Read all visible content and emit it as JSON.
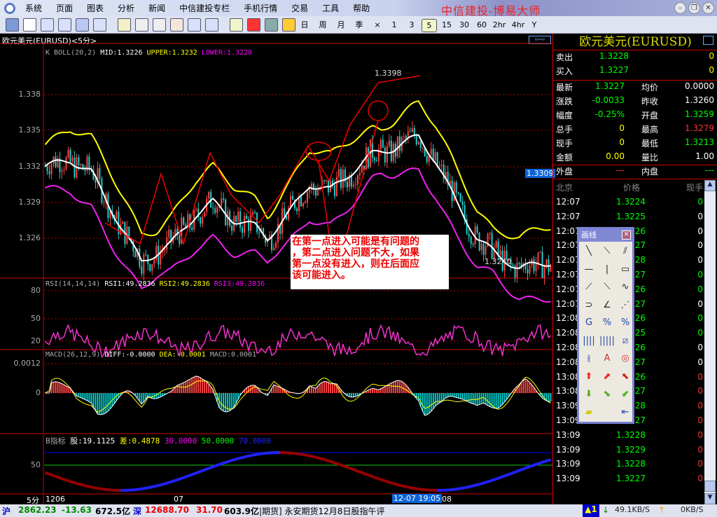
{
  "window": {
    "title": "中信建投-博易大师",
    "min": "–",
    "restore": "❐",
    "close": "✕"
  },
  "menu": [
    "系统",
    "页面",
    "图表",
    "分析",
    "新闻",
    "中信建投专栏",
    "手机行情",
    "交易",
    "工具",
    "帮助"
  ],
  "toolbar": {
    "periods": [
      "日",
      "周",
      "月",
      "季",
      "×",
      "1",
      "3",
      "5",
      "15",
      "30",
      "60",
      "2hr",
      "4hr",
      "Y"
    ],
    "active_period": "5",
    "icons": [
      "back-icon",
      "line-chart-icon",
      "candle-chart-icon",
      "quote-list-icon",
      "info-screen-icon",
      "f10-icon",
      "refresh-icon",
      "zoom-in-icon",
      "zoom-out-icon",
      "hand-select-icon",
      "switch-window-icon",
      "expand-icon",
      "draw-line-icon",
      "alarm-bell-icon",
      "users-icon",
      "lightning-icon"
    ]
  },
  "chart": {
    "title": "欧元美元(EURUSD)<5分>",
    "boll_legend": {
      "name": "K  BOLL(20,2)",
      "mid": "MID:1.3226",
      "upper": "UPPER:1.3232",
      "lower": "LOWER:1.3220"
    },
    "price_ticks": [
      "1.338",
      "1.335",
      "1.332",
      "1.329",
      "1.326"
    ],
    "high_label": "1.3398",
    "low_label": "1.3240",
    "current_price": "1.3309",
    "annotation": [
      "在第一点进入可能是有问题的",
      "，第二点进入问题不大，如果",
      "第一点没有进入，则在后面应",
      "该可能进入。"
    ],
    "rsi_legend": {
      "name": "RSI(14,14,14)",
      "r1": "RSI1:49.2836",
      "r2": "RSI2:49.2836",
      "r3": "RSI3:49.2836"
    },
    "rsi_ticks": [
      "80",
      "50",
      "20"
    ],
    "macd_legend": {
      "name": "MACD(26,12,9)",
      "diff": "DIFF:-0.0000",
      "dea": "DEA:-0.0001",
      "macd": "MACD:0.0001"
    },
    "macd_ticks": [
      "0.0012",
      "0"
    ],
    "b_legend": {
      "name": "B指标",
      "gu": "股:19.1125",
      "cha": "差:0.4878",
      "l30": "30.0000",
      "l50": "50.0000",
      "l70": "70.0000"
    },
    "b_ticks": [
      "50"
    ],
    "time_axis": {
      "period": "5分",
      "labels": [
        "1206",
        "07",
        "08"
      ],
      "cursor": "12-07 19:05"
    }
  },
  "chart_data": {
    "type": "line",
    "price_mid_path": [
      [
        0,
        1.335
      ],
      [
        12,
        1.3355
      ],
      [
        22,
        1.3345
      ],
      [
        36,
        1.33
      ],
      [
        46,
        1.327
      ],
      [
        60,
        1.3285
      ],
      [
        72,
        1.331
      ],
      [
        80,
        1.332
      ],
      [
        90,
        1.3305
      ],
      [
        100,
        1.33
      ],
      [
        106,
        1.329
      ],
      [
        116,
        1.331
      ],
      [
        126,
        1.3335
      ],
      [
        136,
        1.333
      ],
      [
        146,
        1.3345
      ],
      [
        156,
        1.336
      ],
      [
        166,
        1.3365
      ],
      [
        178,
        1.3375
      ],
      [
        186,
        1.3355
      ],
      [
        196,
        1.332
      ],
      [
        206,
        1.329
      ],
      [
        216,
        1.3275
      ],
      [
        226,
        1.3265
      ],
      [
        241,
        1.327
      ]
    ],
    "bars": 242
  },
  "quote": {
    "title": "欧元美元(EURUSD)",
    "sell": {
      "label": "卖出",
      "price": "1.3228",
      "vol": "0"
    },
    "buy": {
      "label": "买入",
      "price": "1.3227",
      "vol": "0"
    },
    "rows": [
      [
        "最新",
        "1.3227",
        "均价",
        "0.0000"
      ],
      [
        "涨跌",
        "-0.0033",
        "昨收",
        "1.3260"
      ],
      [
        "幅度",
        "-0.25%",
        "开盘",
        "1.3259"
      ],
      [
        "总手",
        "0",
        "最高",
        "1.3279"
      ],
      [
        "现手",
        "0",
        "最低",
        "1.3213"
      ],
      [
        "金额",
        "0.00",
        "量比",
        "1.00"
      ]
    ],
    "outer": {
      "label": "外盘",
      "value": "---"
    },
    "inner": {
      "label": "内盘",
      "value": "---"
    },
    "tick_headers": [
      "北京",
      "价格",
      "现手"
    ],
    "ticks": [
      [
        "12:07",
        "1.3224",
        "0",
        "g"
      ],
      [
        "12:07",
        "1.3225",
        "0",
        "w"
      ],
      [
        "12:07",
        "1.3226",
        "0",
        "w"
      ],
      [
        "12:07",
        "1.3227",
        "0",
        "w"
      ],
      [
        "12:07",
        "1.3228",
        "0",
        "w"
      ],
      [
        "12:07",
        "1.3227",
        "0",
        "g"
      ],
      [
        "12:07",
        "1.3226",
        "0",
        "g"
      ],
      [
        "12:07",
        "1.3227",
        "0",
        "w"
      ],
      [
        "12:08",
        "1.3226",
        "0",
        "g"
      ],
      [
        "12:08",
        "1.3225",
        "0",
        "g"
      ],
      [
        "12:08",
        "1.3226",
        "0",
        "w"
      ],
      [
        "12:08",
        "1.3227",
        "0",
        "w"
      ],
      [
        "13:08",
        "1.3226",
        "0",
        "r"
      ],
      [
        "13:08",
        "1.3227",
        "0",
        "r"
      ],
      [
        "13:09",
        "1.3228",
        "0",
        "r"
      ],
      [
        "13:09",
        "1.3227",
        "0",
        "r"
      ],
      [
        "13:09",
        "1.3228",
        "0",
        "r"
      ],
      [
        "13:09",
        "1.3229",
        "0",
        "r"
      ],
      [
        "13:09",
        "1.3228",
        "0",
        "r"
      ],
      [
        "13:09",
        "1.3227",
        "0",
        "r"
      ]
    ]
  },
  "draw_panel": {
    "title": "画线",
    "close": "✕",
    "tools": [
      "line-icon",
      "segment-icon",
      "parallel-lines-icon",
      "horizontal-line-icon",
      "vertical-line-icon",
      "rectangle-icon",
      "ray-up-icon",
      "ray-down-icon",
      "wave-icon",
      "arc-icon",
      "angle-icon",
      "gann-fan-icon",
      "fib-retracement-icon",
      "percent-lines-icon",
      "percent-lines-2-icon",
      "time-cycles-icon",
      "fib-time-icon",
      "speed-lines-icon",
      "andrews-pitchfork-icon",
      "text-icon",
      "gann-circle-icon",
      "arrow-up-icon",
      "arrow-up-right-icon",
      "arrow-up-left-icon",
      "arrow-down-icon",
      "arrow-down-right-icon",
      "arrow-down-left-icon",
      "eraser-icon",
      "delete-all-icon"
    ],
    "glyphs": [
      "╲",
      "⟍",
      "⫽",
      "—",
      "|",
      "▭",
      "⟋",
      "⟍",
      "∿",
      "⊃",
      "∠",
      "⋰",
      "G",
      "%",
      "%",
      "||||",
      "|||||",
      "⧄",
      "⫲",
      "A",
      "◎",
      "⬆",
      "⬈",
      "⬉",
      "⬇",
      "⬊",
      "⬋",
      "▰",
      "⇤"
    ]
  },
  "status": {
    "sh_label": "沪",
    "sh_index": "2862.23",
    "sh_change": "-13.63",
    "sh_amount": "672.5亿",
    "sz_label": "深",
    "sz_index": "12688.70",
    "sz_change": "31.70",
    "sz_amount": "603.9亿",
    "news": "|期货] 永安期货12月8日股指午评",
    "alert": "▲1",
    "down_speed": "49.1KB/S",
    "up_speed": "0KB/S"
  }
}
